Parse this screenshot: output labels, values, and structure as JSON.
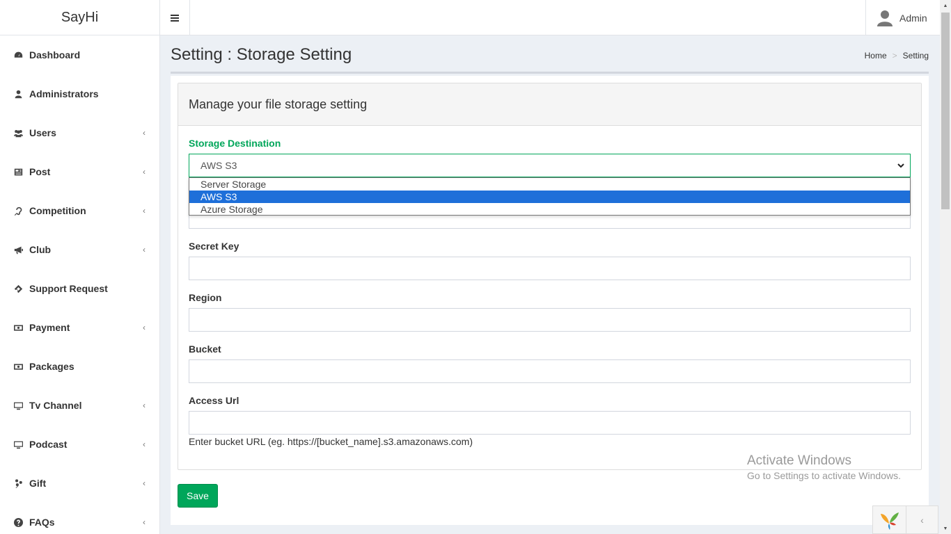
{
  "app": {
    "title": "SayHi"
  },
  "header": {
    "user_name": "Admin"
  },
  "sidebar": {
    "items": [
      {
        "label": "Dashboard",
        "icon": "dashboard-icon",
        "has_submenu": false
      },
      {
        "label": "Administrators",
        "icon": "user-icon",
        "has_submenu": false
      },
      {
        "label": "Users",
        "icon": "users-icon",
        "has_submenu": true
      },
      {
        "label": "Post",
        "icon": "newspaper-icon",
        "has_submenu": true
      },
      {
        "label": "Competition",
        "icon": "assistive-listening-icon",
        "has_submenu": true
      },
      {
        "label": "Club",
        "icon": "bullhorn-icon",
        "has_submenu": true
      },
      {
        "label": "Support Request",
        "icon": "ticket-icon",
        "has_submenu": false
      },
      {
        "label": "Payment",
        "icon": "money-icon",
        "has_submenu": true
      },
      {
        "label": "Packages",
        "icon": "money-icon",
        "has_submenu": false
      },
      {
        "label": "Tv Channel",
        "icon": "desktop-icon",
        "has_submenu": true
      },
      {
        "label": "Podcast",
        "icon": "desktop-icon",
        "has_submenu": true
      },
      {
        "label": "Gift",
        "icon": "gift-icon",
        "has_submenu": true
      },
      {
        "label": "FAQs",
        "icon": "question-circle-icon",
        "has_submenu": true
      }
    ]
  },
  "page": {
    "title": "Setting : Storage Setting",
    "breadcrumb": [
      "Home",
      "Setting"
    ]
  },
  "form": {
    "heading": "Manage your file storage setting",
    "storage_destination": {
      "label": "Storage Destination",
      "value": "AWS S3",
      "options": [
        "Server Storage",
        "AWS S3",
        "Azure Storage"
      ],
      "selected_index": 1
    },
    "secret_key": {
      "label": "Secret Key",
      "value": ""
    },
    "region": {
      "label": "Region",
      "value": ""
    },
    "bucket": {
      "label": "Bucket",
      "value": ""
    },
    "access_url": {
      "label": "Access Url",
      "value": "",
      "hint": "Enter bucket URL (eg. https://[bucket_name].s3.amazonaws.com)"
    },
    "save_label": "Save"
  },
  "watermark": {
    "line1": "Activate Windows",
    "line2": "Go to Settings to activate Windows."
  },
  "colors": {
    "accent_green": "#00a65a",
    "selected_option": "#1e6fd9"
  }
}
